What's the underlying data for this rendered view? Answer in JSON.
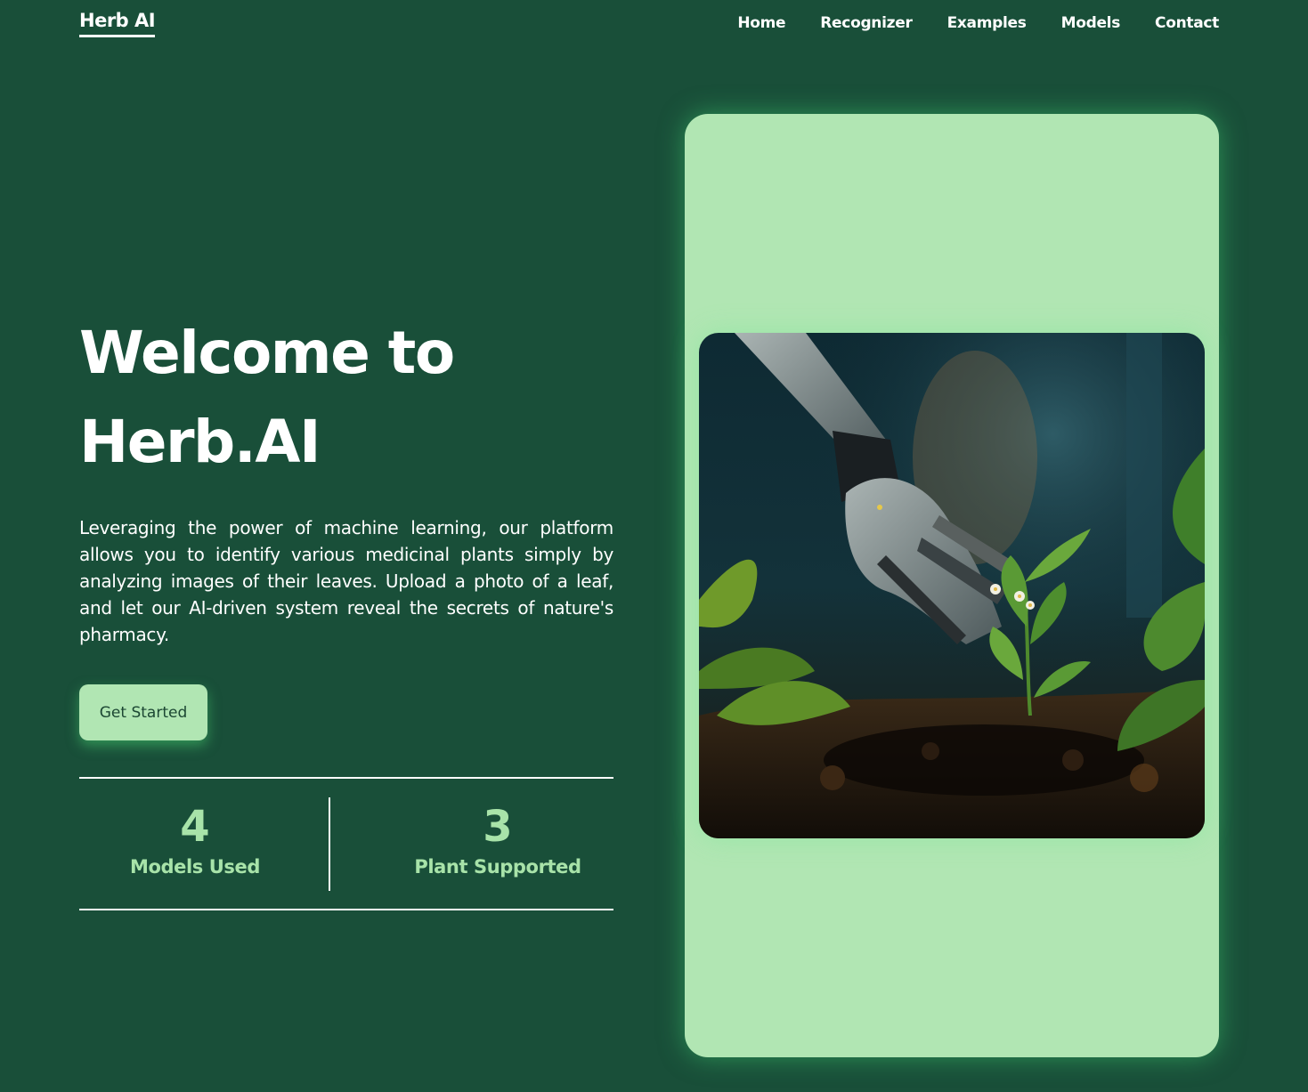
{
  "brand": {
    "name": "Herb AI"
  },
  "nav": {
    "items": [
      {
        "label": "Home"
      },
      {
        "label": "Recognizer"
      },
      {
        "label": "Examples"
      },
      {
        "label": "Models"
      },
      {
        "label": "Contact"
      }
    ]
  },
  "hero": {
    "title_line1": "Welcome to",
    "title_line2": "Herb.AI",
    "description": "Leveraging the power of machine learning, our platform allows you to identify various medicinal plants simply by analyzing images of their leaves. Upload a photo of a leaf, and let our AI-driven system reveal the secrets of nature's pharmacy.",
    "cta_label": "Get Started"
  },
  "stats": [
    {
      "value": "4",
      "label": "Models Used"
    },
    {
      "value": "3",
      "label": "Plant Supported"
    }
  ],
  "colors": {
    "background": "#194f39",
    "accent_light": "#b1e6b3",
    "stat_text": "#a8e3a9",
    "button_text": "#1c4733"
  }
}
